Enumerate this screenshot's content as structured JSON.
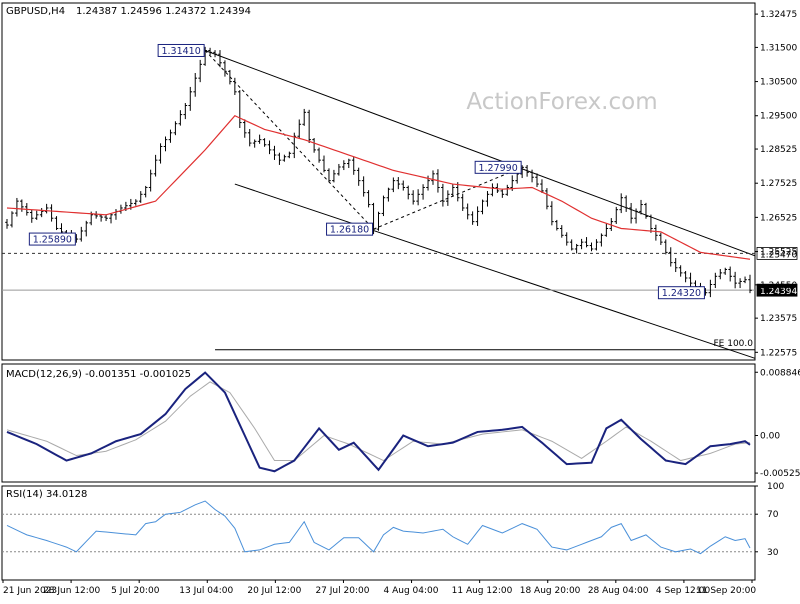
{
  "header": {
    "symbol": "GBPUSD,H4",
    "ohlc": "1.24387 1.24596 1.24372 1.24394"
  },
  "watermark": "ActionForex.com",
  "colors": {
    "price": "#000000",
    "ma": "#e03030",
    "channel": "#000000",
    "macd": "#1a237e",
    "signal": "#aaaaaa",
    "rsi": "#4a90d9",
    "label_box": "#1a237e",
    "dashed_level": "#333333"
  },
  "chart_data": [
    {
      "type": "line",
      "panel": "price",
      "ylim": [
        1.2235,
        1.328
      ],
      "ylabels": [
        "1.32475",
        "1.31500",
        "1.30500",
        "1.29500",
        "1.28525",
        "1.27525",
        "1.26525",
        "1.25525",
        "1.24550",
        "1.23575",
        "1.22575"
      ],
      "yticks": [
        1.32475,
        1.315,
        1.305,
        1.295,
        1.28525,
        1.27525,
        1.26525,
        1.25525,
        1.2455,
        1.23575,
        1.22575
      ],
      "xlabels": [
        "21 Jun 2023",
        "28 Jun 12:00",
        "5 Jul 20:00",
        "13 Jul 04:00",
        "20 Jul 12:00",
        "27 Jul 20:00",
        "4 Aug 04:00",
        "11 Aug 12:00",
        "18 Aug 20:00",
        "28 Aug 04:00",
        "4 Sep 12:00",
        "11 Sep 20:00"
      ],
      "price_anchors": [
        [
          0,
          1.263
        ],
        [
          2,
          1.27
        ],
        [
          5,
          1.265
        ],
        [
          8,
          1.268
        ],
        [
          10,
          1.262
        ],
        [
          12,
          1.26
        ],
        [
          14,
          1.2589
        ],
        [
          17,
          1.266
        ],
        [
          20,
          1.265
        ],
        [
          23,
          1.268
        ],
        [
          26,
          1.27
        ],
        [
          28,
          1.274
        ],
        [
          31,
          1.286
        ],
        [
          33,
          1.29
        ],
        [
          36,
          1.298
        ],
        [
          38,
          1.306
        ],
        [
          40,
          1.3141
        ],
        [
          42,
          1.313
        ],
        [
          44,
          1.308
        ],
        [
          46,
          1.302
        ],
        [
          47,
          1.293
        ],
        [
          49,
          1.287
        ],
        [
          51,
          1.288
        ],
        [
          53,
          1.285
        ],
        [
          55,
          1.282
        ],
        [
          57,
          1.284
        ],
        [
          58,
          1.289
        ],
        [
          60,
          1.296
        ],
        [
          61,
          1.288
        ],
        [
          63,
          1.282
        ],
        [
          65,
          1.276
        ],
        [
          67,
          1.28
        ],
        [
          69,
          1.282
        ],
        [
          71,
          1.276
        ],
        [
          73,
          1.269
        ],
        [
          74,
          1.2618
        ],
        [
          76,
          1.271
        ],
        [
          78,
          1.276
        ],
        [
          80,
          1.274
        ],
        [
          82,
          1.27
        ],
        [
          84,
          1.274
        ],
        [
          86,
          1.278
        ],
        [
          88,
          1.27
        ],
        [
          90,
          1.274
        ],
        [
          92,
          1.268
        ],
        [
          94,
          1.264
        ],
        [
          96,
          1.27
        ],
        [
          98,
          1.274
        ],
        [
          100,
          1.272
        ],
        [
          102,
          1.276
        ],
        [
          104,
          1.2799
        ],
        [
          106,
          1.277
        ],
        [
          108,
          1.273
        ],
        [
          110,
          1.264
        ],
        [
          112,
          1.26
        ],
        [
          114,
          1.256
        ],
        [
          116,
          1.258
        ],
        [
          118,
          1.256
        ],
        [
          120,
          1.26
        ],
        [
          122,
          1.264
        ],
        [
          124,
          1.271
        ],
        [
          126,
          1.265
        ],
        [
          128,
          1.269
        ],
        [
          130,
          1.262
        ],
        [
          132,
          1.258
        ],
        [
          134,
          1.252
        ],
        [
          136,
          1.249
        ],
        [
          138,
          1.246
        ],
        [
          140,
          1.244
        ],
        [
          141,
          1.2432
        ],
        [
          143,
          1.248
        ],
        [
          145,
          1.25
        ],
        [
          147,
          1.246
        ],
        [
          149,
          1.247
        ],
        [
          150,
          1.2439
        ]
      ],
      "ma_anchors": [
        [
          0,
          1.268
        ],
        [
          10,
          1.267
        ],
        [
          20,
          1.266
        ],
        [
          30,
          1.27
        ],
        [
          40,
          1.285
        ],
        [
          46,
          1.295
        ],
        [
          52,
          1.291
        ],
        [
          60,
          1.288
        ],
        [
          70,
          1.283
        ],
        [
          78,
          1.279
        ],
        [
          90,
          1.275
        ],
        [
          100,
          1.2735
        ],
        [
          106,
          1.274
        ],
        [
          112,
          1.27
        ],
        [
          118,
          1.265
        ],
        [
          124,
          1.262
        ],
        [
          132,
          1.261
        ],
        [
          140,
          1.255
        ],
        [
          150,
          1.253
        ]
      ],
      "bar_count": 151,
      "labels": [
        {
          "text": "1.31410",
          "bar": 40,
          "price": 1.3141,
          "side": "left"
        },
        {
          "text": "1.25890",
          "bar": 14,
          "price": 1.2589,
          "side": "left"
        },
        {
          "text": "1.26180",
          "bar": 74,
          "price": 1.2618,
          "side": "left"
        },
        {
          "text": "1.27990",
          "bar": 104,
          "price": 1.2799,
          "side": "left"
        },
        {
          "text": "1.24320",
          "bar": 141,
          "price": 1.2432,
          "side": "left"
        }
      ],
      "levels": [
        {
          "value": 1.2547,
          "label": "1.25470",
          "style": "dashed",
          "box": "white"
        },
        {
          "value": 1.24394,
          "label": "1.24394",
          "style": "solid",
          "box": "black"
        }
      ],
      "channel_upper": [
        [
          40,
          1.3141
        ],
        [
          151,
          1.254
        ]
      ],
      "channel_lower": [
        [
          46,
          1.275
        ],
        [
          151,
          1.224
        ]
      ],
      "fib_guides": [
        [
          [
            40,
            1.3141
          ],
          [
            74,
            1.2618
          ]
        ],
        [
          [
            74,
            1.2618
          ],
          [
            104,
            1.2799
          ]
        ]
      ],
      "fe_line": {
        "value": 1.2265,
        "from_bar": 42,
        "label": "FE 100.0"
      }
    },
    {
      "type": "line",
      "panel": "macd",
      "title": "MACD(12,26,9) -0.001351 -0.001025",
      "ylim": [
        -0.0065,
        0.01
      ],
      "ylabels": [
        "0.008846",
        "0.00",
        "-0.005252"
      ],
      "yticks": [
        0.008846,
        0.0,
        -0.005252
      ],
      "macd_anchors": [
        [
          0,
          0.0005
        ],
        [
          6,
          -0.0012
        ],
        [
          12,
          -0.0035
        ],
        [
          17,
          -0.0025
        ],
        [
          22,
          -0.0008
        ],
        [
          27,
          0.0002
        ],
        [
          32,
          0.003
        ],
        [
          36,
          0.0065
        ],
        [
          40,
          0.0088
        ],
        [
          44,
          0.006
        ],
        [
          48,
          0.0
        ],
        [
          51,
          -0.0045
        ],
        [
          54,
          -0.005
        ],
        [
          58,
          -0.0035
        ],
        [
          63,
          0.001
        ],
        [
          67,
          -0.002
        ],
        [
          70,
          -0.001
        ],
        [
          75,
          -0.0048
        ],
        [
          80,
          0.0
        ],
        [
          85,
          -0.0015
        ],
        [
          90,
          -0.001
        ],
        [
          95,
          0.0005
        ],
        [
          100,
          0.0008
        ],
        [
          104,
          0.0012
        ],
        [
          108,
          -0.001
        ],
        [
          113,
          -0.004
        ],
        [
          118,
          -0.0038
        ],
        [
          121,
          0.001
        ],
        [
          124,
          0.0022
        ],
        [
          128,
          -0.0005
        ],
        [
          133,
          -0.0035
        ],
        [
          137,
          -0.004
        ],
        [
          142,
          -0.0015
        ],
        [
          146,
          -0.0012
        ],
        [
          149,
          -0.0008
        ],
        [
          150,
          -0.0013
        ]
      ],
      "signal_anchors": [
        [
          0,
          0.0008
        ],
        [
          8,
          -0.0008
        ],
        [
          14,
          -0.0028
        ],
        [
          20,
          -0.0022
        ],
        [
          26,
          -0.0006
        ],
        [
          32,
          0.002
        ],
        [
          37,
          0.0055
        ],
        [
          41,
          0.0075
        ],
        [
          45,
          0.006
        ],
        [
          50,
          0.001
        ],
        [
          54,
          -0.0035
        ],
        [
          58,
          -0.0035
        ],
        [
          64,
          0.0
        ],
        [
          69,
          -0.0012
        ],
        [
          76,
          -0.0035
        ],
        [
          82,
          -0.0008
        ],
        [
          88,
          -0.0012
        ],
        [
          96,
          0.0002
        ],
        [
          104,
          0.0008
        ],
        [
          110,
          -0.0008
        ],
        [
          116,
          -0.0032
        ],
        [
          121,
          -0.0008
        ],
        [
          125,
          0.0012
        ],
        [
          130,
          -0.0008
        ],
        [
          136,
          -0.0035
        ],
        [
          142,
          -0.0025
        ],
        [
          147,
          -0.0012
        ],
        [
          150,
          -0.001
        ]
      ]
    },
    {
      "type": "line",
      "panel": "rsi",
      "title": "RSI(14) 34.0128",
      "ylim": [
        0,
        100
      ],
      "ylabels": [
        "100",
        "70",
        "30",
        "0"
      ],
      "yticks": [
        100,
        70,
        30,
        0
      ],
      "levels": [
        70,
        30
      ],
      "rsi_anchors": [
        [
          0,
          58
        ],
        [
          4,
          48
        ],
        [
          8,
          42
        ],
        [
          12,
          35
        ],
        [
          14,
          30
        ],
        [
          18,
          52
        ],
        [
          22,
          50
        ],
        [
          26,
          48
        ],
        [
          28,
          60
        ],
        [
          30,
          62
        ],
        [
          32,
          70
        ],
        [
          35,
          72
        ],
        [
          38,
          80
        ],
        [
          40,
          84
        ],
        [
          42,
          75
        ],
        [
          44,
          68
        ],
        [
          46,
          55
        ],
        [
          48,
          30
        ],
        [
          51,
          32
        ],
        [
          54,
          38
        ],
        [
          57,
          40
        ],
        [
          60,
          62
        ],
        [
          62,
          40
        ],
        [
          65,
          32
        ],
        [
          68,
          45
        ],
        [
          71,
          45
        ],
        [
          74,
          30
        ],
        [
          76,
          48
        ],
        [
          78,
          56
        ],
        [
          80,
          52
        ],
        [
          84,
          50
        ],
        [
          88,
          54
        ],
        [
          90,
          46
        ],
        [
          93,
          38
        ],
        [
          96,
          58
        ],
        [
          100,
          50
        ],
        [
          104,
          60
        ],
        [
          107,
          54
        ],
        [
          110,
          35
        ],
        [
          113,
          32
        ],
        [
          116,
          38
        ],
        [
          120,
          46
        ],
        [
          122,
          56
        ],
        [
          124,
          60
        ],
        [
          126,
          42
        ],
        [
          129,
          48
        ],
        [
          132,
          35
        ],
        [
          135,
          30
        ],
        [
          138,
          33
        ],
        [
          140,
          28
        ],
        [
          142,
          36
        ],
        [
          145,
          46
        ],
        [
          147,
          42
        ],
        [
          149,
          44
        ],
        [
          150,
          34
        ]
      ]
    }
  ]
}
